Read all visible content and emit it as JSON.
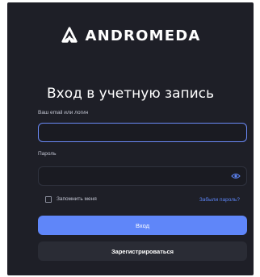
{
  "brand": {
    "logo_text": "ANDROMEDA"
  },
  "form": {
    "title": "Вход в учетную запись",
    "login_label": "Ваш email или логин",
    "login_value": "",
    "password_label": "Пароль",
    "password_value": "",
    "remember_label": "Запомнить меня",
    "forgot_link": "Забыли пароль?",
    "submit_label": "Вход",
    "register_label": "Зарегистрироваться"
  },
  "colors": {
    "card_background": "#1e1f27",
    "accent": "#5f86f9",
    "secondary_button": "#2a2c35"
  }
}
